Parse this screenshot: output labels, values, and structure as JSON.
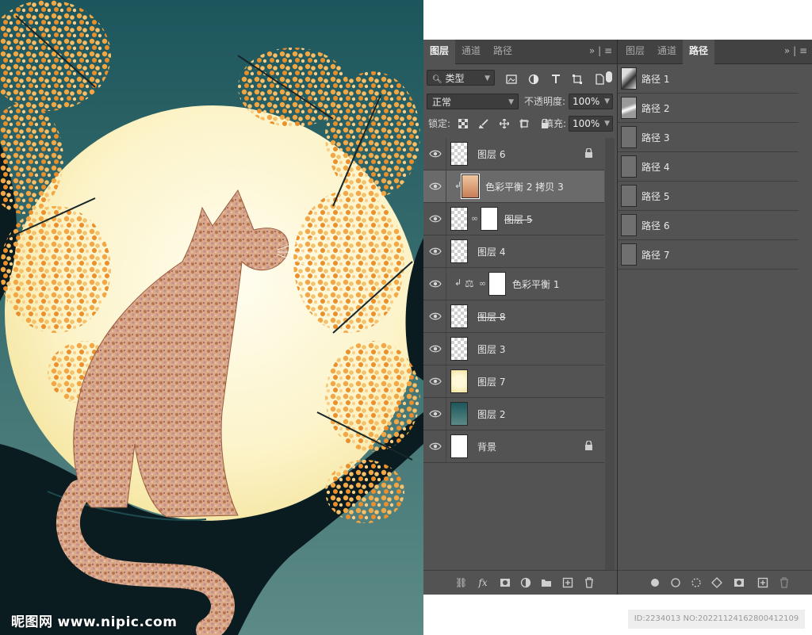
{
  "artwork": {
    "watermark_cn": "昵图网",
    "watermark_url": "www.nipic.com"
  },
  "layers_panel": {
    "tabs": [
      "图层",
      "通道",
      "路径"
    ],
    "active_tab": "图层",
    "filter_label": "类型",
    "blend_mode": "正常",
    "opacity_label": "不透明度:",
    "opacity_value": "100%",
    "lock_label": "锁定:",
    "fill_label": "填充:",
    "fill_value": "100%",
    "layers": [
      {
        "name": "图层 6",
        "thumb": "checker",
        "locked": true
      },
      {
        "name": "色彩平衡 2 拷贝 3",
        "thumb": "cat",
        "clipped": true,
        "selected": true
      },
      {
        "name": "图层 5",
        "thumb": "cat-dark",
        "mask": true,
        "strike": true
      },
      {
        "name": "图层 4",
        "thumb": "checker"
      },
      {
        "name": "色彩平衡 1",
        "thumb": "adjustment",
        "mask": true,
        "clipped": true
      },
      {
        "name": "图层 8",
        "thumb": "pattern",
        "strike": true
      },
      {
        "name": "图层 3",
        "thumb": "branch"
      },
      {
        "name": "图层 7",
        "thumb": "moon"
      },
      {
        "name": "图层 2",
        "thumb": "teal"
      },
      {
        "name": "背景",
        "thumb": "white",
        "locked": true
      }
    ]
  },
  "paths_panel": {
    "tabs": [
      "图层",
      "通道",
      "路径"
    ],
    "active_tab": "路径",
    "paths": [
      "路径 1",
      "路径 2",
      "路径 3",
      "路径 4",
      "路径 5",
      "路径 6",
      "路径 7"
    ]
  },
  "id_text": "ID:2234013 NO:20221124162800412109",
  "colors": {
    "panel_bg": "#535353",
    "tabbar_bg": "#424242",
    "sky_top": "#1d5a5f",
    "moon": "#fdf7d4",
    "foliage": "#f2a347",
    "branch": "#0a1a1f"
  }
}
